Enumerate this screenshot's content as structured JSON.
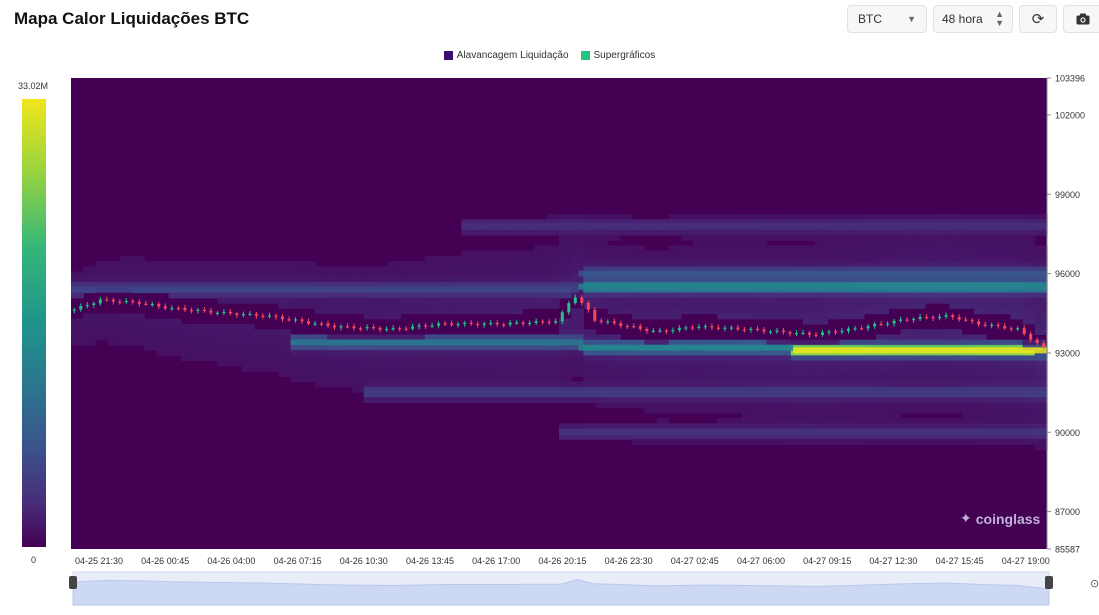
{
  "header": {
    "title": "Mapa Calor Liquidações BTC",
    "coin": "BTC",
    "range": "48 hora"
  },
  "legend": [
    {
      "label": "Alavancagem Liquidação",
      "color": "#3b0f70"
    },
    {
      "label": "Supergráficos",
      "color": "#22c480"
    }
  ],
  "colorbar": {
    "max_label": "33.02M",
    "min_label": "0"
  },
  "watermark": "coinglass",
  "icons": {
    "refresh": "refresh-icon",
    "camera": "camera-icon",
    "coin_caret": "chevron-down-icon",
    "range_caret": "up-down-icon",
    "watermark": "coinglass-logo-icon"
  },
  "chart_data": {
    "type": "heatmap",
    "title": "Mapa Calor Liquidações BTC",
    "y_ticks": [
      "103396",
      "102000",
      "99000",
      "96000",
      "93000",
      "90000",
      "87000",
      "85587"
    ],
    "ylim": [
      85587,
      103396
    ],
    "x_ticks": [
      "04-25 21:30",
      "04-26 00:45",
      "04-26 04:00",
      "04-26 07:15",
      "04-26 10:30",
      "04-26 13:45",
      "04-26 17:00",
      "04-26 20:15",
      "04-26 23:30",
      "04-27 02:45",
      "04-27 06:00",
      "04-27 09:15",
      "04-27 12:30",
      "04-27 15:45",
      "04-27 19:00"
    ],
    "color_range": [
      0,
      33020000
    ],
    "price_anchors": [
      {
        "t": 0,
        "price": 94600
      },
      {
        "t": 0.03,
        "price": 95000
      },
      {
        "t": 0.07,
        "price": 94900
      },
      {
        "t": 0.1,
        "price": 94700
      },
      {
        "t": 0.16,
        "price": 94500
      },
      {
        "t": 0.2,
        "price": 94400
      },
      {
        "t": 0.27,
        "price": 94000
      },
      {
        "t": 0.33,
        "price": 93900
      },
      {
        "t": 0.38,
        "price": 94100
      },
      {
        "t": 0.44,
        "price": 94100
      },
      {
        "t": 0.5,
        "price": 94200
      },
      {
        "t": 0.53,
        "price": 94600
      },
      {
        "t": 0.5,
        "price": 94300
      },
      {
        "t": 0.515,
        "price": 95200
      },
      {
        "t": 0.53,
        "price": 94300
      },
      {
        "t": 0.6,
        "price": 93800
      },
      {
        "t": 0.64,
        "price": 94000
      },
      {
        "t": 0.69,
        "price": 93900
      },
      {
        "t": 0.76,
        "price": 93700
      },
      {
        "t": 0.8,
        "price": 93900
      },
      {
        "t": 0.86,
        "price": 94300
      },
      {
        "t": 0.9,
        "price": 94400
      },
      {
        "t": 0.93,
        "price": 94100
      },
      {
        "t": 0.97,
        "price": 93900
      },
      {
        "t": 1,
        "price": 93100
      }
    ],
    "liquidation_bands": [
      {
        "price": 95400,
        "t_start": 0.0,
        "t_end": 0.52,
        "intensity": 0.22
      },
      {
        "price": 95500,
        "t_start": 0.52,
        "t_end": 1.0,
        "intensity": 0.55
      },
      {
        "price": 93400,
        "t_start": 0.23,
        "t_end": 0.52,
        "intensity": 0.45
      },
      {
        "price": 93200,
        "t_start": 0.52,
        "t_end": 0.74,
        "intensity": 0.55
      },
      {
        "price": 93100,
        "t_start": 0.74,
        "t_end": 1.0,
        "intensity": 0.95
      },
      {
        "price": 96000,
        "t_start": 0.52,
        "t_end": 1.0,
        "intensity": 0.3
      },
      {
        "price": 91500,
        "t_start": 0.3,
        "t_end": 1.0,
        "intensity": 0.18
      },
      {
        "price": 90000,
        "t_start": 0.5,
        "t_end": 1.0,
        "intensity": 0.14
      },
      {
        "price": 97800,
        "t_start": 0.4,
        "t_end": 1.0,
        "intensity": 0.12
      }
    ],
    "grid": false,
    "legend_position": "top-center"
  }
}
